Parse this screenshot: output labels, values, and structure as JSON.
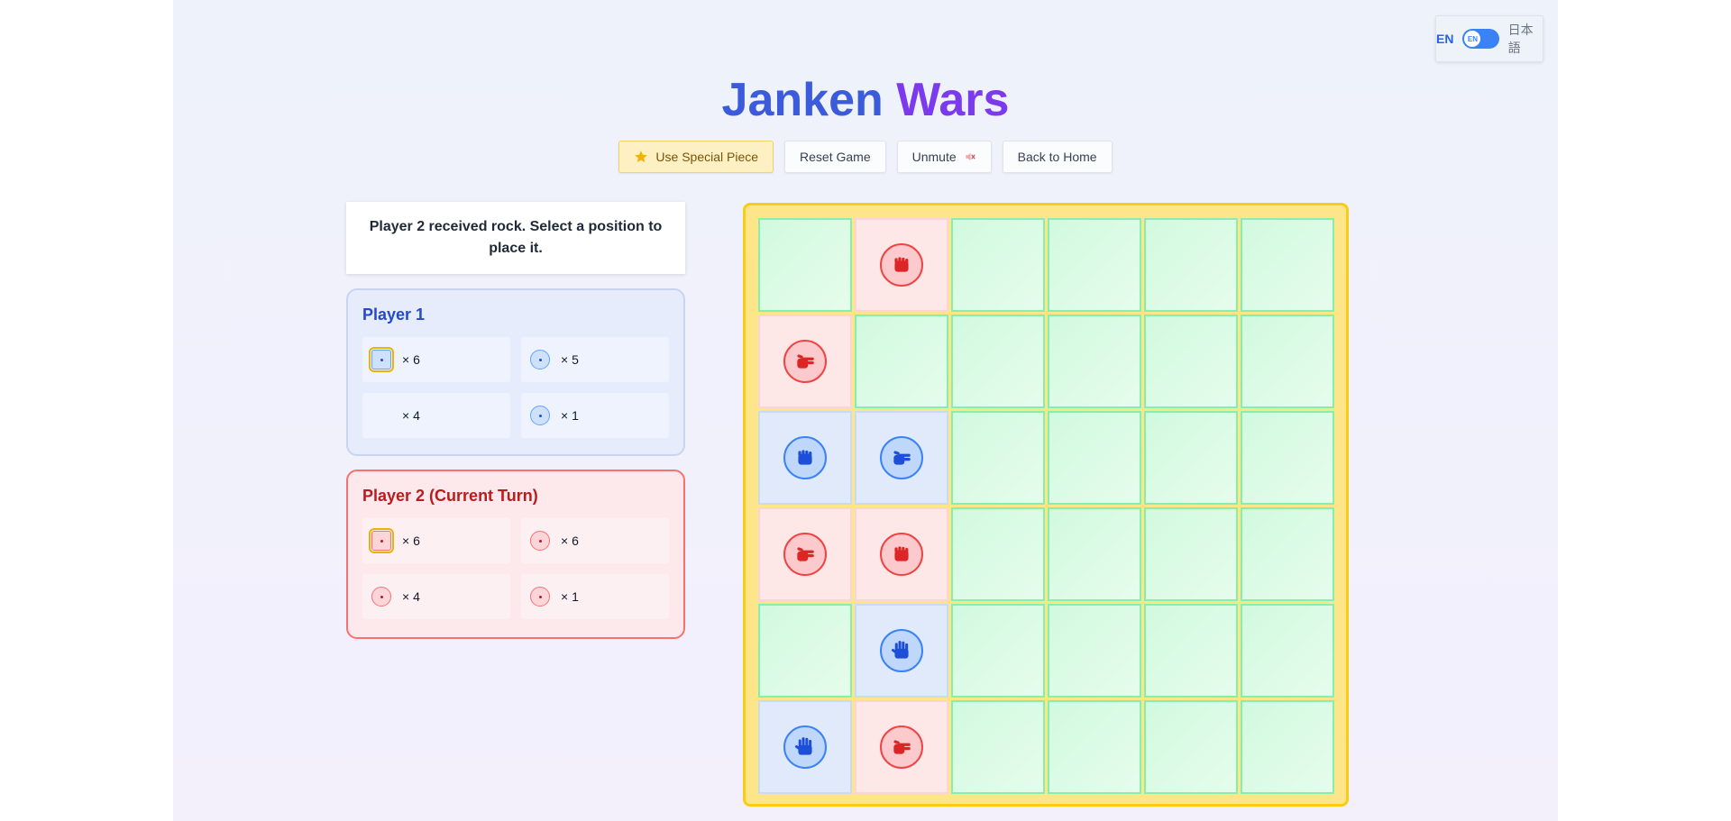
{
  "language": {
    "en": "EN",
    "ja": "日本語",
    "knob": "EN"
  },
  "title": {
    "part1": "Janken",
    "part2": "Wars"
  },
  "toolbar": {
    "special": "Use Special Piece",
    "reset": "Reset Game",
    "mute": "Unmute",
    "home": "Back to Home"
  },
  "message": "Player 2 received rock. Select a position to place it.",
  "player1": {
    "name": "Player 1",
    "hand": [
      {
        "count": "× 6",
        "icon": "rock",
        "selected": true
      },
      {
        "count": "× 5",
        "icon": "paper",
        "selected": false
      },
      {
        "count": "× 4",
        "icon": "none",
        "selected": false
      },
      {
        "count": "× 1",
        "icon": "special",
        "selected": false
      }
    ]
  },
  "player2": {
    "name": "Player 2 (Current Turn)",
    "hand": [
      {
        "count": "× 6",
        "icon": "rock",
        "selected": true
      },
      {
        "count": "× 6",
        "icon": "paper",
        "selected": false
      },
      {
        "count": "× 4",
        "icon": "scissors",
        "selected": false
      },
      {
        "count": "× 1",
        "icon": "special",
        "selected": false
      }
    ]
  },
  "board": [
    [
      "empty",
      "red:rock",
      "empty",
      "empty",
      "empty",
      "empty"
    ],
    [
      "red:scissors",
      "empty",
      "empty",
      "empty",
      "empty",
      "empty"
    ],
    [
      "blue:rock",
      "blue:scissors",
      "empty",
      "empty",
      "empty",
      "empty"
    ],
    [
      "red:scissors",
      "red:rock",
      "empty",
      "empty",
      "empty",
      "empty"
    ],
    [
      "empty",
      "blue:paper",
      "empty",
      "empty",
      "empty",
      "empty"
    ],
    [
      "blue:paper",
      "red:scissors",
      "empty",
      "empty",
      "empty",
      "empty"
    ]
  ],
  "colors": {
    "player1": "#3b82f6",
    "player2": "#ef4444",
    "board": "#fde68a",
    "cell": "#d1fadf"
  }
}
